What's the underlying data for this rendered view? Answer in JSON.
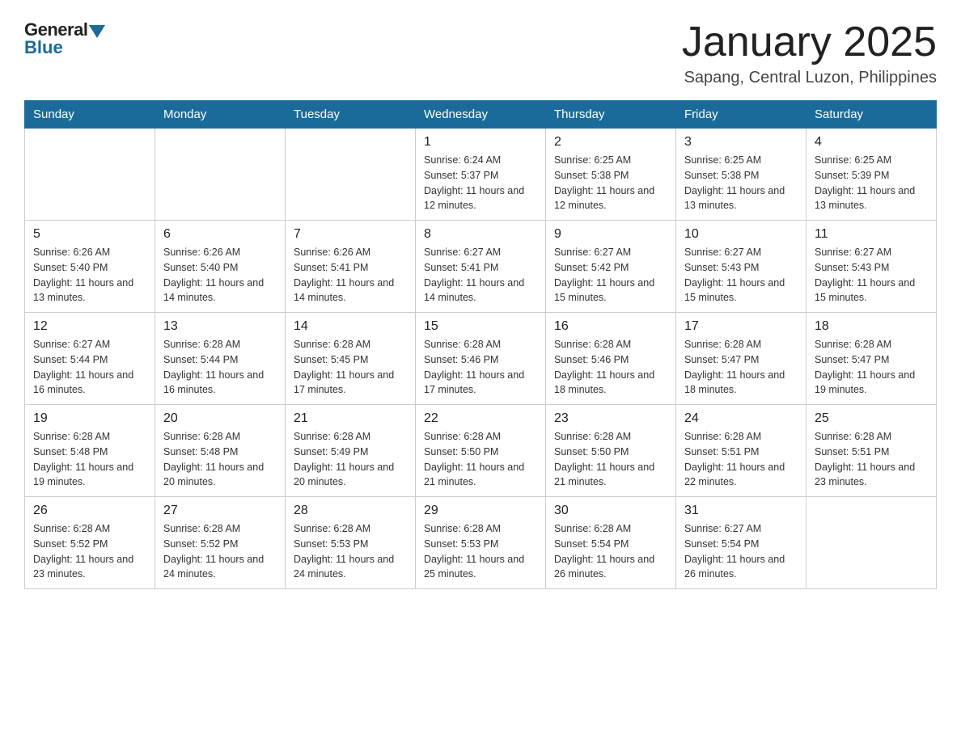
{
  "logo": {
    "general": "General",
    "blue": "Blue"
  },
  "header": {
    "month_year": "January 2025",
    "location": "Sapang, Central Luzon, Philippines"
  },
  "days_of_week": [
    "Sunday",
    "Monday",
    "Tuesday",
    "Wednesday",
    "Thursday",
    "Friday",
    "Saturday"
  ],
  "weeks": [
    [
      {
        "day": "",
        "sunrise": "",
        "sunset": "",
        "daylight": ""
      },
      {
        "day": "",
        "sunrise": "",
        "sunset": "",
        "daylight": ""
      },
      {
        "day": "",
        "sunrise": "",
        "sunset": "",
        "daylight": ""
      },
      {
        "day": "1",
        "sunrise": "Sunrise: 6:24 AM",
        "sunset": "Sunset: 5:37 PM",
        "daylight": "Daylight: 11 hours and 12 minutes."
      },
      {
        "day": "2",
        "sunrise": "Sunrise: 6:25 AM",
        "sunset": "Sunset: 5:38 PM",
        "daylight": "Daylight: 11 hours and 12 minutes."
      },
      {
        "day": "3",
        "sunrise": "Sunrise: 6:25 AM",
        "sunset": "Sunset: 5:38 PM",
        "daylight": "Daylight: 11 hours and 13 minutes."
      },
      {
        "day": "4",
        "sunrise": "Sunrise: 6:25 AM",
        "sunset": "Sunset: 5:39 PM",
        "daylight": "Daylight: 11 hours and 13 minutes."
      }
    ],
    [
      {
        "day": "5",
        "sunrise": "Sunrise: 6:26 AM",
        "sunset": "Sunset: 5:40 PM",
        "daylight": "Daylight: 11 hours and 13 minutes."
      },
      {
        "day": "6",
        "sunrise": "Sunrise: 6:26 AM",
        "sunset": "Sunset: 5:40 PM",
        "daylight": "Daylight: 11 hours and 14 minutes."
      },
      {
        "day": "7",
        "sunrise": "Sunrise: 6:26 AM",
        "sunset": "Sunset: 5:41 PM",
        "daylight": "Daylight: 11 hours and 14 minutes."
      },
      {
        "day": "8",
        "sunrise": "Sunrise: 6:27 AM",
        "sunset": "Sunset: 5:41 PM",
        "daylight": "Daylight: 11 hours and 14 minutes."
      },
      {
        "day": "9",
        "sunrise": "Sunrise: 6:27 AM",
        "sunset": "Sunset: 5:42 PM",
        "daylight": "Daylight: 11 hours and 15 minutes."
      },
      {
        "day": "10",
        "sunrise": "Sunrise: 6:27 AM",
        "sunset": "Sunset: 5:43 PM",
        "daylight": "Daylight: 11 hours and 15 minutes."
      },
      {
        "day": "11",
        "sunrise": "Sunrise: 6:27 AM",
        "sunset": "Sunset: 5:43 PM",
        "daylight": "Daylight: 11 hours and 15 minutes."
      }
    ],
    [
      {
        "day": "12",
        "sunrise": "Sunrise: 6:27 AM",
        "sunset": "Sunset: 5:44 PM",
        "daylight": "Daylight: 11 hours and 16 minutes."
      },
      {
        "day": "13",
        "sunrise": "Sunrise: 6:28 AM",
        "sunset": "Sunset: 5:44 PM",
        "daylight": "Daylight: 11 hours and 16 minutes."
      },
      {
        "day": "14",
        "sunrise": "Sunrise: 6:28 AM",
        "sunset": "Sunset: 5:45 PM",
        "daylight": "Daylight: 11 hours and 17 minutes."
      },
      {
        "day": "15",
        "sunrise": "Sunrise: 6:28 AM",
        "sunset": "Sunset: 5:46 PM",
        "daylight": "Daylight: 11 hours and 17 minutes."
      },
      {
        "day": "16",
        "sunrise": "Sunrise: 6:28 AM",
        "sunset": "Sunset: 5:46 PM",
        "daylight": "Daylight: 11 hours and 18 minutes."
      },
      {
        "day": "17",
        "sunrise": "Sunrise: 6:28 AM",
        "sunset": "Sunset: 5:47 PM",
        "daylight": "Daylight: 11 hours and 18 minutes."
      },
      {
        "day": "18",
        "sunrise": "Sunrise: 6:28 AM",
        "sunset": "Sunset: 5:47 PM",
        "daylight": "Daylight: 11 hours and 19 minutes."
      }
    ],
    [
      {
        "day": "19",
        "sunrise": "Sunrise: 6:28 AM",
        "sunset": "Sunset: 5:48 PM",
        "daylight": "Daylight: 11 hours and 19 minutes."
      },
      {
        "day": "20",
        "sunrise": "Sunrise: 6:28 AM",
        "sunset": "Sunset: 5:48 PM",
        "daylight": "Daylight: 11 hours and 20 minutes."
      },
      {
        "day": "21",
        "sunrise": "Sunrise: 6:28 AM",
        "sunset": "Sunset: 5:49 PM",
        "daylight": "Daylight: 11 hours and 20 minutes."
      },
      {
        "day": "22",
        "sunrise": "Sunrise: 6:28 AM",
        "sunset": "Sunset: 5:50 PM",
        "daylight": "Daylight: 11 hours and 21 minutes."
      },
      {
        "day": "23",
        "sunrise": "Sunrise: 6:28 AM",
        "sunset": "Sunset: 5:50 PM",
        "daylight": "Daylight: 11 hours and 21 minutes."
      },
      {
        "day": "24",
        "sunrise": "Sunrise: 6:28 AM",
        "sunset": "Sunset: 5:51 PM",
        "daylight": "Daylight: 11 hours and 22 minutes."
      },
      {
        "day": "25",
        "sunrise": "Sunrise: 6:28 AM",
        "sunset": "Sunset: 5:51 PM",
        "daylight": "Daylight: 11 hours and 23 minutes."
      }
    ],
    [
      {
        "day": "26",
        "sunrise": "Sunrise: 6:28 AM",
        "sunset": "Sunset: 5:52 PM",
        "daylight": "Daylight: 11 hours and 23 minutes."
      },
      {
        "day": "27",
        "sunrise": "Sunrise: 6:28 AM",
        "sunset": "Sunset: 5:52 PM",
        "daylight": "Daylight: 11 hours and 24 minutes."
      },
      {
        "day": "28",
        "sunrise": "Sunrise: 6:28 AM",
        "sunset": "Sunset: 5:53 PM",
        "daylight": "Daylight: 11 hours and 24 minutes."
      },
      {
        "day": "29",
        "sunrise": "Sunrise: 6:28 AM",
        "sunset": "Sunset: 5:53 PM",
        "daylight": "Daylight: 11 hours and 25 minutes."
      },
      {
        "day": "30",
        "sunrise": "Sunrise: 6:28 AM",
        "sunset": "Sunset: 5:54 PM",
        "daylight": "Daylight: 11 hours and 26 minutes."
      },
      {
        "day": "31",
        "sunrise": "Sunrise: 6:27 AM",
        "sunset": "Sunset: 5:54 PM",
        "daylight": "Daylight: 11 hours and 26 minutes."
      },
      {
        "day": "",
        "sunrise": "",
        "sunset": "",
        "daylight": ""
      }
    ]
  ]
}
